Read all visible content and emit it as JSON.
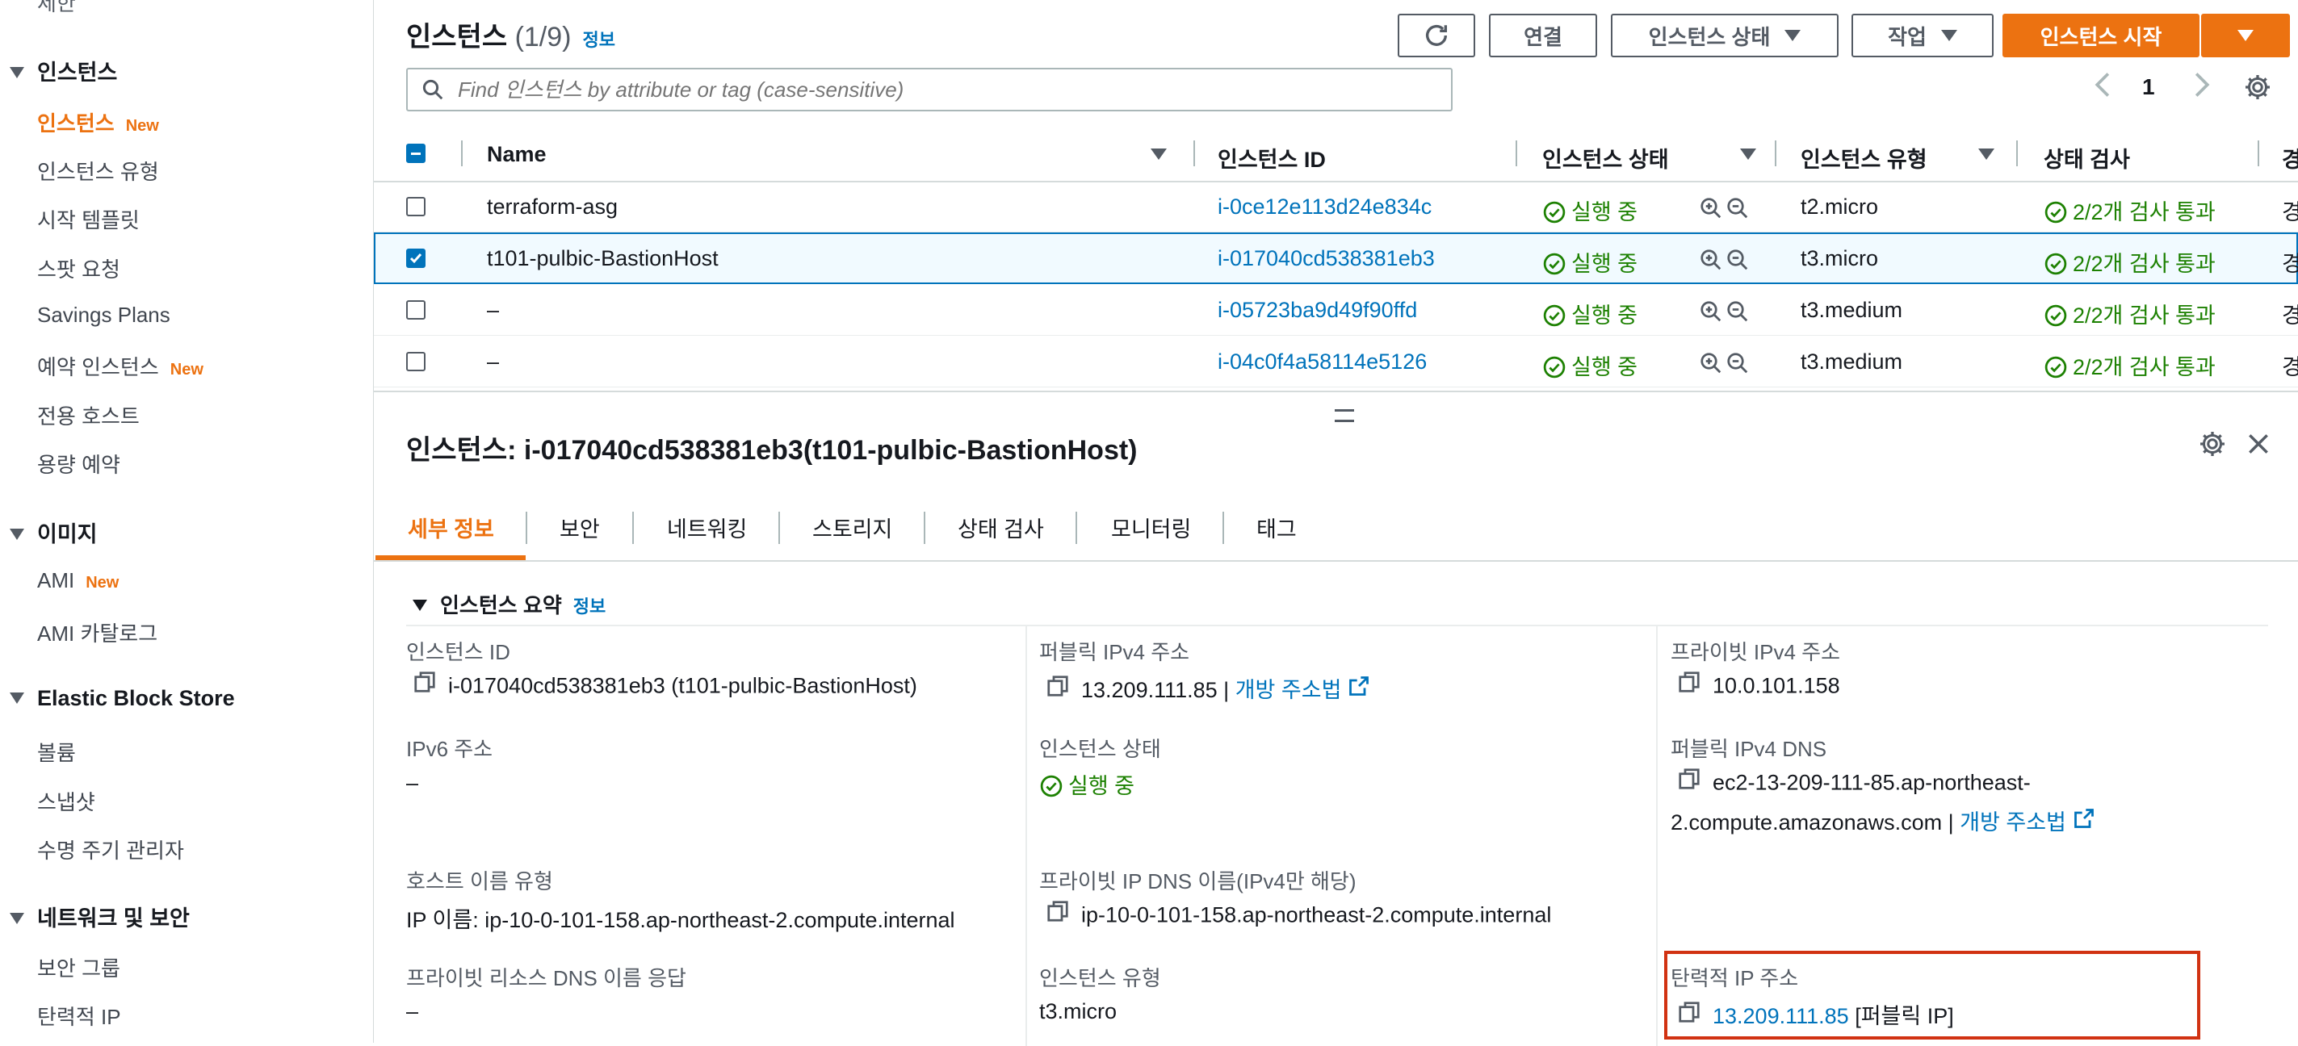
{
  "sidebar": {
    "top_cut_item": "제한",
    "sections": [
      {
        "label": "인스턴스",
        "items": [
          {
            "label": "인스턴스",
            "badge": "New",
            "active": true
          },
          {
            "label": "인스턴스 유형"
          },
          {
            "label": "시작 템플릿"
          },
          {
            "label": "스팟 요청"
          },
          {
            "label": "Savings Plans"
          },
          {
            "label": "예약 인스턴스",
            "badge": "New"
          },
          {
            "label": "전용 호스트"
          },
          {
            "label": "용량 예약"
          }
        ]
      },
      {
        "label": "이미지",
        "items": [
          {
            "label": "AMI",
            "badge": "New"
          },
          {
            "label": "AMI 카탈로그"
          }
        ]
      },
      {
        "label": "Elastic Block Store",
        "items": [
          {
            "label": "볼륨"
          },
          {
            "label": "스냅샷"
          },
          {
            "label": "수명 주기 관리자"
          }
        ]
      },
      {
        "label": "네트워크 및 보안",
        "items": [
          {
            "label": "보안 그룹"
          },
          {
            "label": "탄력적 IP"
          }
        ]
      }
    ]
  },
  "header": {
    "title": "인스턴스",
    "count": "(1/9)",
    "info": "정보",
    "buttons": {
      "connect": "연결",
      "instance_state": "인스턴스 상태",
      "actions": "작업",
      "launch": "인스턴스 시작"
    },
    "search_placeholder": "Find 인스턴스 by attribute or tag (case-sensitive)",
    "page_number": "1"
  },
  "table": {
    "columns": [
      "Name",
      "인스턴스 ID",
      "인스턴스 상태",
      "인스턴스 유형",
      "상태 검사",
      "경"
    ],
    "rows": [
      {
        "name": "terraform-asg",
        "id": "i-0ce12e113d24e834c",
        "state": "실행 중",
        "type": "t2.micro",
        "check": "2/2개 검사 통과",
        "cut": "경",
        "selected": false
      },
      {
        "name": "t101-pulbic-BastionHost",
        "id": "i-017040cd538381eb3",
        "state": "실행 중",
        "type": "t3.micro",
        "check": "2/2개 검사 통과",
        "cut": "경",
        "selected": true
      },
      {
        "name": "–",
        "id": "i-05723ba9d49f90ffd",
        "state": "실행 중",
        "type": "t3.medium",
        "check": "2/2개 검사 통과",
        "cut": "경",
        "selected": false
      },
      {
        "name": "–",
        "id": "i-04c0f4a58114e5126",
        "state": "실행 중",
        "type": "t3.medium",
        "check": "2/2개 검사 통과",
        "cut": "경",
        "selected": false
      }
    ]
  },
  "detail": {
    "title": "인스턴스: i-017040cd538381eb3(t101-pulbic-BastionHost)",
    "tabs": [
      "세부 정보",
      "보안",
      "네트워킹",
      "스토리지",
      "상태 검사",
      "모니터링",
      "태그"
    ],
    "summary_title": "인스턴스 요약",
    "summary_info": "정보",
    "fields": {
      "instance_id_label": "인스턴스 ID",
      "instance_id_value": "i-017040cd538381eb3 (t101-pulbic-BastionHost)",
      "public_ipv4_label": "퍼블릭 IPv4 주소",
      "public_ipv4_value": "13.209.111.85",
      "open_address": "개방 주소법",
      "private_ipv4_label": "프라이빗 IPv4 주소",
      "private_ipv4_value": "10.0.101.158",
      "ipv6_label": "IPv6 주소",
      "ipv6_value": "–",
      "state_label": "인스턴스 상태",
      "state_value": "실행 중",
      "public_dns_label": "퍼블릭 IPv4 DNS",
      "public_dns_line1": "ec2-13-209-111-85.ap-northeast-",
      "public_dns_line2": "2.compute.amazonaws.com",
      "hostname_type_label": "호스트 이름 유형",
      "hostname_type_value": "IP 이름: ip-10-0-101-158.ap-northeast-2.compute.internal",
      "private_dns_label": "프라이빗 IP DNS 이름(IPv4만 해당)",
      "private_dns_value": "ip-10-0-101-158.ap-northeast-2.compute.internal",
      "resource_dns_label": "프라이빗 리소스 DNS 이름 응답",
      "resource_dns_value": "–",
      "instance_type_label": "인스턴스 유형",
      "instance_type_value": "t3.micro",
      "elastic_ip_label": "탄력적 IP 주소",
      "elastic_ip_value": "13.209.111.85",
      "elastic_ip_suffix": "[퍼블릭 IP]"
    }
  },
  "colors": {
    "accent": "#ec7211",
    "link": "#0073bb",
    "success": "#1d8102",
    "highlight_box": "#d13212"
  },
  "icons": [
    "refresh-icon",
    "search-icon",
    "chevron-left-icon",
    "chevron-right-icon",
    "gear-icon",
    "close-icon",
    "copy-icon",
    "external-link-icon",
    "check-circle-icon",
    "zoom-in-icon",
    "zoom-out-icon"
  ]
}
